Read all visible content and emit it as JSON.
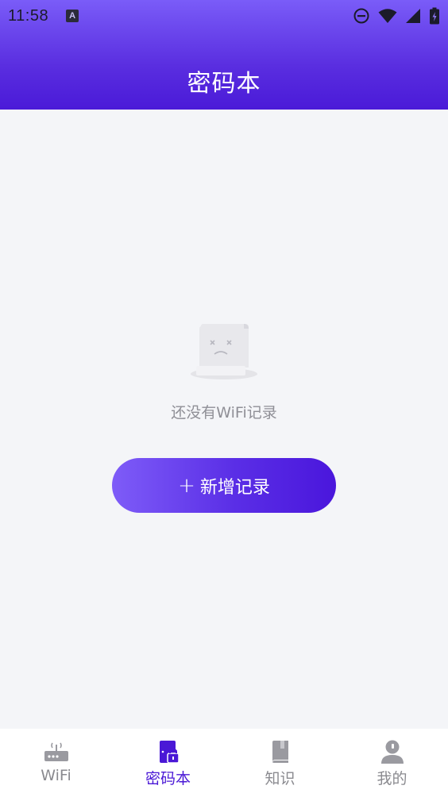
{
  "status_bar": {
    "time": "11:58",
    "notification_icon": "a-icon"
  },
  "header": {
    "title": "密码本"
  },
  "empty_state": {
    "illustration": "empty-paper-icon",
    "message": "还没有WiFi记录"
  },
  "add_button": {
    "label": "新增记录",
    "icon": "+"
  },
  "tabs": [
    {
      "label": "WiFi",
      "icon": "router-icon",
      "active": false
    },
    {
      "label": "密码本",
      "icon": "password-book-icon",
      "active": true
    },
    {
      "label": "知识",
      "icon": "book-icon",
      "active": false
    },
    {
      "label": "我的",
      "icon": "user-icon",
      "active": false
    }
  ],
  "colors": {
    "accent": "#4a18d6",
    "header_top": "#7a5cf8",
    "header_bottom": "#4a1ad8",
    "background": "#f4f5f8",
    "inactive": "#8a8a8f"
  }
}
